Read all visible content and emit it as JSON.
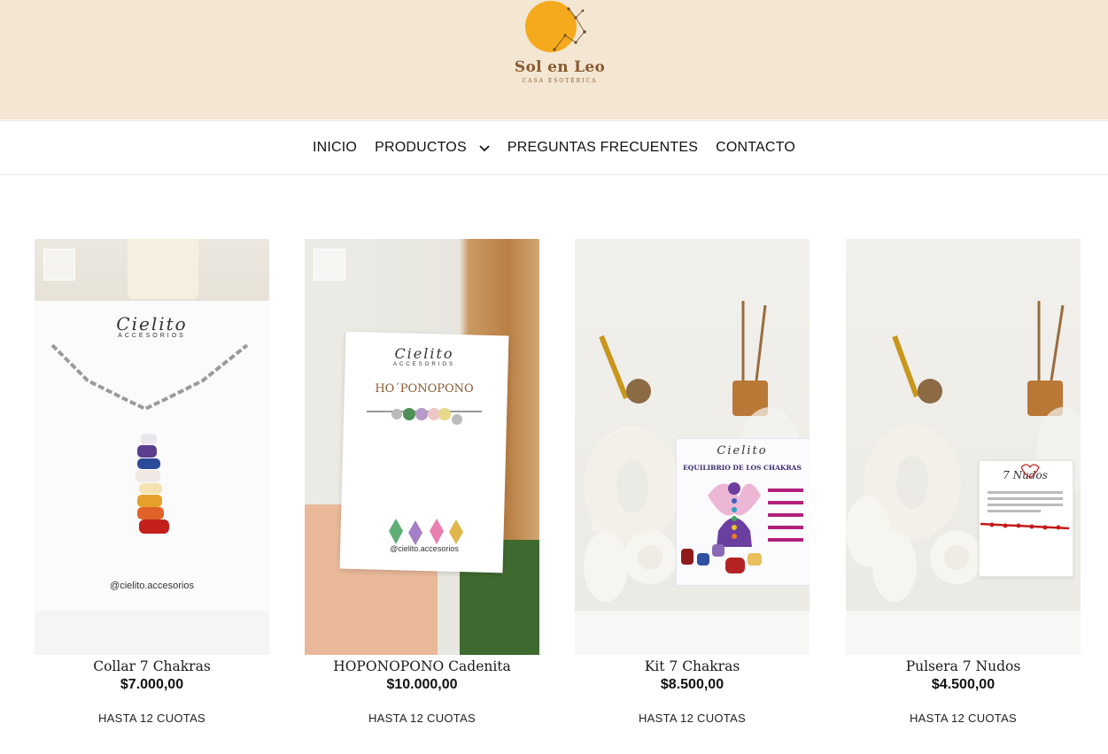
{
  "brand": {
    "name": "Sol en Leo",
    "tagline": "CASA ESOTÉRICA",
    "sun_color": "#f5a91c",
    "text_color": "#8a5a2f"
  },
  "nav": {
    "items": [
      {
        "label": "INICIO"
      },
      {
        "label": "PRODUCTOS",
        "has_dropdown": true
      },
      {
        "label": "PREGUNTAS FRECUENTES"
      },
      {
        "label": "CONTACTO"
      }
    ]
  },
  "products": [
    {
      "name": "Collar 7 Chakras",
      "price": "$7.000,00",
      "installments": "HASTA 12 CUOTAS",
      "card_brand": "Cielito",
      "card_sub": "ACCESORIOS",
      "card_handle": "@cielito.accesorios"
    },
    {
      "name": "HOPONOPONO Cadenita",
      "price": "$10.000,00",
      "installments": "HASTA 12 CUOTAS",
      "card_brand": "Cielito",
      "card_sub": "ACCESORIOS",
      "card_title": "HO´PONOPONO",
      "card_handle": "@cielito.accesorios"
    },
    {
      "name": "Kit 7 Chakras",
      "price": "$8.500,00",
      "installments": "HASTA 12 CUOTAS",
      "card_brand": "Cielito",
      "card_title": "EQUILIBRIO DE LOS CHAKRAS"
    },
    {
      "name": "Pulsera 7 Nudos",
      "price": "$4.500,00",
      "installments": "HASTA 12 CUOTAS",
      "card_title": "7 Nudos"
    }
  ]
}
